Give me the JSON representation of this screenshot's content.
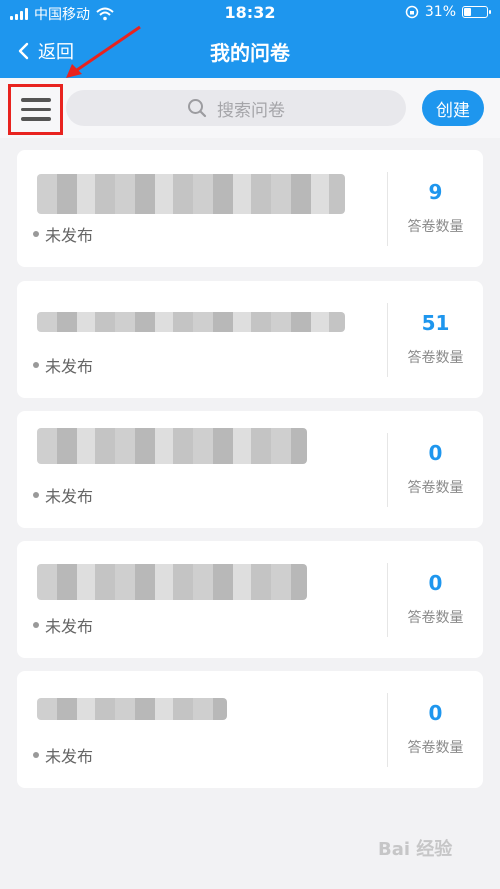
{
  "status_bar": {
    "carrier": "中国移动",
    "time": "18:32",
    "battery": "31%",
    "battery_level": 0.31
  },
  "nav": {
    "back_label": "返回",
    "title": "我的问卷"
  },
  "search": {
    "placeholder": "搜索问卷"
  },
  "create_label": "创建",
  "surveys": [
    {
      "status": "未发布",
      "count": "9",
      "count_label": "答卷数量"
    },
    {
      "status": "未发布",
      "count": "51",
      "count_label": "答卷数量"
    },
    {
      "status": "未发布",
      "count": "0",
      "count_label": "答卷数量"
    },
    {
      "status": "未发布",
      "count": "0",
      "count_label": "答卷数量"
    },
    {
      "status": "未发布",
      "count": "0",
      "count_label": "答卷数量"
    }
  ],
  "watermark": "Bai 经验",
  "colors": {
    "primary": "#1e96ee",
    "annotation": "#e8231f"
  }
}
